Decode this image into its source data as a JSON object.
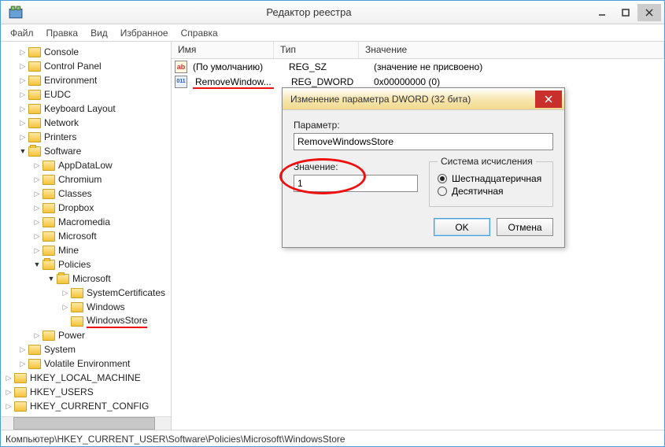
{
  "window": {
    "title": "Редактор реестра"
  },
  "menu": {
    "file": "Файл",
    "edit": "Правка",
    "view": "Вид",
    "favorites": "Избранное",
    "help": "Справка"
  },
  "tree": {
    "items": [
      {
        "label": "Console",
        "depth": 1,
        "open": false,
        "twist": true
      },
      {
        "label": "Control Panel",
        "depth": 1,
        "open": false,
        "twist": true
      },
      {
        "label": "Environment",
        "depth": 1,
        "open": false,
        "twist": true
      },
      {
        "label": "EUDC",
        "depth": 1,
        "open": false,
        "twist": true
      },
      {
        "label": "Keyboard Layout",
        "depth": 1,
        "open": false,
        "twist": true
      },
      {
        "label": "Network",
        "depth": 1,
        "open": false,
        "twist": true
      },
      {
        "label": "Printers",
        "depth": 1,
        "open": false,
        "twist": true
      },
      {
        "label": "Software",
        "depth": 1,
        "open": true,
        "twist": true
      },
      {
        "label": "AppDataLow",
        "depth": 2,
        "open": false,
        "twist": true
      },
      {
        "label": "Chromium",
        "depth": 2,
        "open": false,
        "twist": true
      },
      {
        "label": "Classes",
        "depth": 2,
        "open": false,
        "twist": true
      },
      {
        "label": "Dropbox",
        "depth": 2,
        "open": false,
        "twist": true
      },
      {
        "label": "Macromedia",
        "depth": 2,
        "open": false,
        "twist": true
      },
      {
        "label": "Microsoft",
        "depth": 2,
        "open": false,
        "twist": true
      },
      {
        "label": "Mine",
        "depth": 2,
        "open": false,
        "twist": true
      },
      {
        "label": "Policies",
        "depth": 2,
        "open": true,
        "twist": true
      },
      {
        "label": "Microsoft",
        "depth": 3,
        "open": true,
        "twist": true
      },
      {
        "label": "SystemCertificates",
        "depth": 4,
        "open": false,
        "twist": true
      },
      {
        "label": "Windows",
        "depth": 4,
        "open": false,
        "twist": true
      },
      {
        "label": "WindowsStore",
        "depth": 4,
        "open": false,
        "twist": false,
        "underline": true
      },
      {
        "label": "Power",
        "depth": 2,
        "open": false,
        "twist": true
      },
      {
        "label": "System",
        "depth": 1,
        "open": false,
        "twist": true
      },
      {
        "label": "Volatile Environment",
        "depth": 1,
        "open": false,
        "twist": true
      },
      {
        "label": "HKEY_LOCAL_MACHINE",
        "depth": 0,
        "open": false,
        "twist": true
      },
      {
        "label": "HKEY_USERS",
        "depth": 0,
        "open": false,
        "twist": true
      },
      {
        "label": "HKEY_CURRENT_CONFIG",
        "depth": 0,
        "open": false,
        "twist": true
      }
    ]
  },
  "list": {
    "headers": {
      "name": "Имя",
      "type": "Тип",
      "value": "Значение"
    },
    "rows": [
      {
        "icon": "sz",
        "name": "(По умолчанию)",
        "type": "REG_SZ",
        "value": "(значение не присвоено)",
        "underline": false
      },
      {
        "icon": "dw",
        "name": "RemoveWindow...",
        "type": "REG_DWORD",
        "value": "0x00000000 (0)",
        "underline": true
      }
    ]
  },
  "dialog": {
    "title": "Изменение параметра DWORD (32 бита)",
    "param_label": "Параметр:",
    "param_value": "RemoveWindowsStore",
    "value_label": "Значение:",
    "value_value": "1",
    "radix_legend": "Система исчисления",
    "radix_hex": "Шестнадцатеричная",
    "radix_dec": "Десятичная",
    "ok": "OK",
    "cancel": "Отмена"
  },
  "statusbar": {
    "path": "Компьютер\\HKEY_CURRENT_USER\\Software\\Policies\\Microsoft\\WindowsStore"
  }
}
